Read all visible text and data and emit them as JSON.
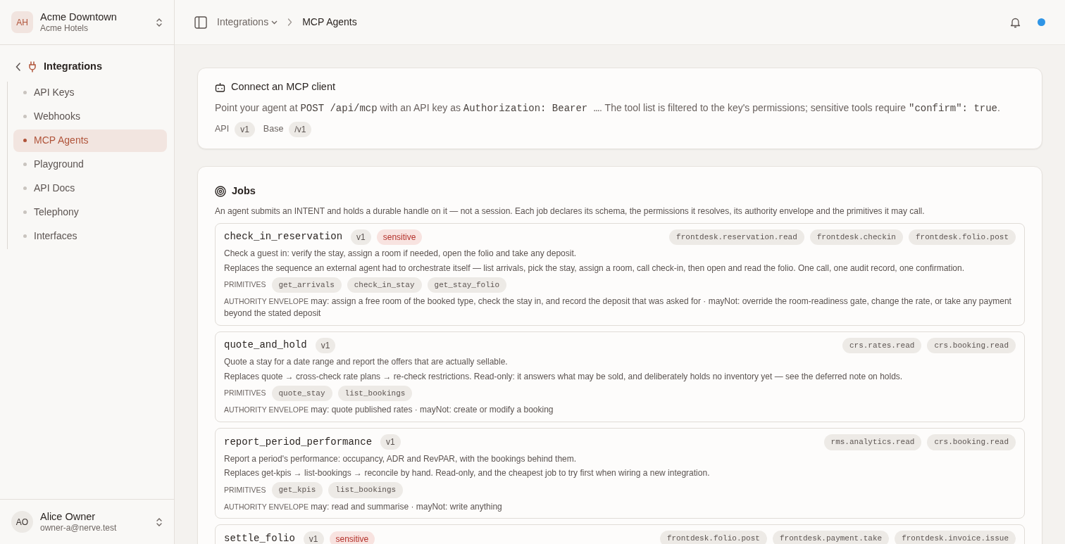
{
  "workspace": {
    "initials": "AH",
    "name": "Acme Downtown",
    "org": "Acme Hotels"
  },
  "sidebar": {
    "section": "Integrations",
    "items": [
      {
        "label": "API Keys",
        "selected": false
      },
      {
        "label": "Webhooks",
        "selected": false
      },
      {
        "label": "MCP Agents",
        "selected": true
      },
      {
        "label": "Playground",
        "selected": false
      },
      {
        "label": "API Docs",
        "selected": false
      },
      {
        "label": "Telephony",
        "selected": false
      },
      {
        "label": "Interfaces",
        "selected": false
      }
    ]
  },
  "user": {
    "initials": "AO",
    "name": "Alice Owner",
    "email": "owner-a@nerve.test"
  },
  "breadcrumb": {
    "parent": "Integrations",
    "current": "MCP Agents"
  },
  "connect_card": {
    "title": "Connect an MCP client",
    "text": [
      {
        "kind": "text",
        "text": "Point your agent at "
      },
      {
        "kind": "code",
        "text": "POST /api/mcp"
      },
      {
        "kind": "text",
        "text": " with an API key as "
      },
      {
        "kind": "code",
        "text": "Authorization: Bearer …"
      },
      {
        "kind": "text",
        "text": ". The tool list is filtered to the key's permissions; sensitive tools require "
      },
      {
        "kind": "code",
        "text": "\"confirm\": true"
      },
      {
        "kind": "text",
        "text": "."
      }
    ],
    "meta": [
      {
        "label": "API",
        "value": "v1"
      },
      {
        "label": "Base",
        "value": "/v1"
      }
    ]
  },
  "jobs": {
    "title": "Jobs",
    "intro": "An agent submits an INTENT and holds a durable handle on it — not a session. Each job declares its schema, the permissions it resolves, its authority envelope and the primitives it may call.",
    "items": [
      {
        "name": "check_in_reservation",
        "version": "v1",
        "sensitive": true,
        "sensitive_label": "sensitive",
        "permissions": [
          "frontdesk.reservation.read",
          "frontdesk.checkin",
          "frontdesk.folio.post"
        ],
        "summary": "Check a guest in: verify the stay, assign a room if needed, open the folio and take any deposit.",
        "replaces": "Replaces the sequence an external agent had to orchestrate itself — list arrivals, pick the stay, assign a room, call check-in, then open and read the folio. One call, one audit record, one confirmation.",
        "primitives_label": "PRIMITIVES",
        "primitives": [
          "get_arrivals",
          "check_in_stay",
          "get_stay_folio"
        ],
        "authority_label": "AUTHORITY ENVELOPE",
        "authority": "may: assign a free room of the booked type, check the stay in, and record the deposit that was asked for · mayNot: override the room-readiness gate, change the rate, or take any payment beyond the stated deposit"
      },
      {
        "name": "quote_and_hold",
        "version": "v1",
        "sensitive": false,
        "permissions": [
          "crs.rates.read",
          "crs.booking.read"
        ],
        "summary": "Quote a stay for a date range and report the offers that are actually sellable.",
        "replaces": "Replaces quote → cross-check rate plans → re-check restrictions. Read-only: it answers what may be sold, and deliberately holds no inventory yet — see the deferred note on holds.",
        "primitives_label": "PRIMITIVES",
        "primitives": [
          "quote_stay",
          "list_bookings"
        ],
        "authority_label": "AUTHORITY ENVELOPE",
        "authority": "may: quote published rates · mayNot: create or modify a booking"
      },
      {
        "name": "report_period_performance",
        "version": "v1",
        "sensitive": false,
        "permissions": [
          "rms.analytics.read",
          "crs.booking.read"
        ],
        "summary": "Report a period's performance: occupancy, ADR and RevPAR, with the bookings behind them.",
        "replaces": "Replaces get-kpis → list-bookings → reconcile by hand. Read-only, and the cheapest job to try first when wiring a new integration.",
        "primitives_label": "PRIMITIVES",
        "primitives": [
          "get_kpis",
          "list_bookings"
        ],
        "authority_label": "AUTHORITY ENVELOPE",
        "authority": "may: read and summarise · mayNot: write anything"
      },
      {
        "name": "settle_folio",
        "version": "v1",
        "sensitive": true,
        "sensitive_label": "sensitive",
        "permissions": [
          "frontdesk.folio.post",
          "frontdesk.payment.take",
          "frontdesk.invoice.issue"
        ]
      }
    ]
  }
}
